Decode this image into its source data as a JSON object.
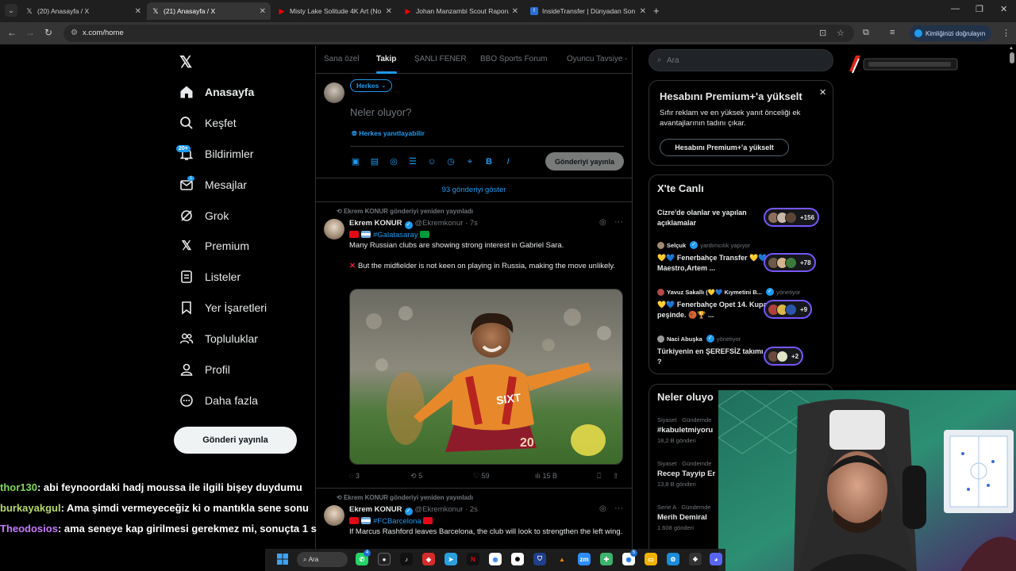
{
  "browser": {
    "tabs": [
      {
        "title": "(20) Anasayfa / X",
        "favicon": "x-icon",
        "active": false
      },
      {
        "title": "(21) Anasayfa / X",
        "favicon": "x-icon",
        "active": true
      },
      {
        "title": "Misty Lake Solitude 4K Art (No",
        "favicon": "youtube-icon",
        "active": false
      },
      {
        "title": "Johan Manzambi Scout Raporu",
        "favicon": "youtube-icon",
        "active": false
      },
      {
        "title": "InsideTransfer | Dünyadan Son",
        "favicon": "insidetransfer-icon",
        "active": false
      }
    ],
    "url": "x.com/home",
    "identity_label": "Kimliğinizi doğrulayın"
  },
  "sidebar": {
    "items": [
      {
        "label": "Anasayfa",
        "icon": "home-icon"
      },
      {
        "label": "Keşfet",
        "icon": "search-icon"
      },
      {
        "label": "Bildirimler",
        "icon": "bell-icon"
      },
      {
        "label": "Mesajlar",
        "icon": "mail-icon"
      },
      {
        "label": "Grok",
        "icon": "grok-icon"
      },
      {
        "label": "Premium",
        "icon": "x-icon"
      },
      {
        "label": "Listeler",
        "icon": "list-icon"
      },
      {
        "label": "Yer İşaretleri",
        "icon": "bookmark-icon"
      },
      {
        "label": "Topluluklar",
        "icon": "people-icon"
      },
      {
        "label": "Profil",
        "icon": "person-icon"
      },
      {
        "label": "Daha fazla",
        "icon": "more-circle-icon"
      }
    ],
    "notif_badge": "20+",
    "msg_badge": "1",
    "post_button": "Gönderi yayınla"
  },
  "chat": [
    {
      "user": "thor130",
      "text": ": abi feynoordaki hadj moussa ile ilgili bişey duydumu"
    },
    {
      "user": "burkayakgul",
      "text": ": Ama şimdi vermeyeceğiz ki o mantıkla sene sonu"
    },
    {
      "user": "Theodosios",
      "text": ": ama seneye kap girilmesi gerekmez mi, sonuçta 1 s"
    }
  ],
  "feed": {
    "tabs": [
      "Sana özel",
      "Takip",
      "ŞANLI FENER",
      "BBO Sports Forum",
      "Oyuncu Tavsiye -"
    ],
    "active_tab": "Takip",
    "compose": {
      "audience": "Herkes",
      "placeholder": "Neler oluyor?",
      "reply_setting": "Herkes yanıtlayabilir",
      "post_button": "Gönderiyi yayınla"
    },
    "show_more": "93 gönderiyi göster",
    "tweets": [
      {
        "repost_line": "Ekrem KONUR gönderiyi yeniden yayınladı",
        "name": "Ekrem KONUR",
        "handle": "@Ekremkonur",
        "time": "· 7s",
        "hashtag": "#Galatasaray",
        "text1": "Many Russian clubs are showing strong interest in Gabriel Sara.",
        "text2": "But the midfielder is not keen on playing in Russia, making the move unlikely.",
        "replies": "3",
        "reposts": "5",
        "likes": "59",
        "views": "15 B"
      },
      {
        "repost_line": "Ekrem KONUR gönderiyi yeniden yayınladı",
        "name": "Ekrem KONUR",
        "handle": "@Ekremkonur",
        "time": "· 2s",
        "hashtag": "#FCBarcelona",
        "text1": "If Marcus Rashford leaves Barcelona, the club will look to strengthen the left wing."
      }
    ]
  },
  "right": {
    "search_placeholder": "Ara",
    "premium": {
      "title": "Hesabını Premium+'a yükselt",
      "desc": "Sıfır reklam ve en yüksek yanıt önceliği ek avantajlarının tadını çıkar.",
      "button": "Hesabını Premium+'a yükselt"
    },
    "live": {
      "title": "X'te Canlı",
      "items": [
        {
          "src_name": "",
          "src_role": "",
          "topic": "Cizre'de olanlar ve yapılan açıklamalar",
          "count": "+156"
        },
        {
          "src_name": "Selçuk",
          "src_role": "yardımcılık yapıyor",
          "topic": "💛💙 Fenerbahçe Transfer 💛💙Maestro,Artem ...",
          "count": "+78"
        },
        {
          "src_name": "Yavuz Sakallı (💛💙 Kıymetini B...",
          "src_role": "yönetiyor",
          "topic": "💛💙 Fenerbahçe Opet 14. Kupa peşinde. 🏀🏆 ...",
          "count": "+9"
        },
        {
          "src_name": "Naci Abuşka",
          "src_role": "yönetiyor",
          "topic": "Türkiyenin en ŞEREFSİZ takımı ?",
          "count": "+2"
        }
      ]
    },
    "trends": {
      "title": "Neler oluyo",
      "items": [
        {
          "category": "Siyaset · Gündemde",
          "name": "#kabuletmiyoru",
          "count": "18,2 B gönderi"
        },
        {
          "category": "Siyaset · Gündemde",
          "name": "Recep Tayyip Er",
          "count": "13,8 B gönderi"
        },
        {
          "category": "Serie A · Gündemde",
          "name": "Merih Demiral",
          "count": "1.608 gönderi"
        }
      ]
    }
  },
  "taskbar": {
    "search_label": "Ara",
    "whatsapp_badge": "4",
    "chrome_badge": "5"
  },
  "colors": {
    "accent": "#1d9bf0",
    "live_border": "#7856ff",
    "background": "#000000",
    "divider": "#2f3336"
  }
}
